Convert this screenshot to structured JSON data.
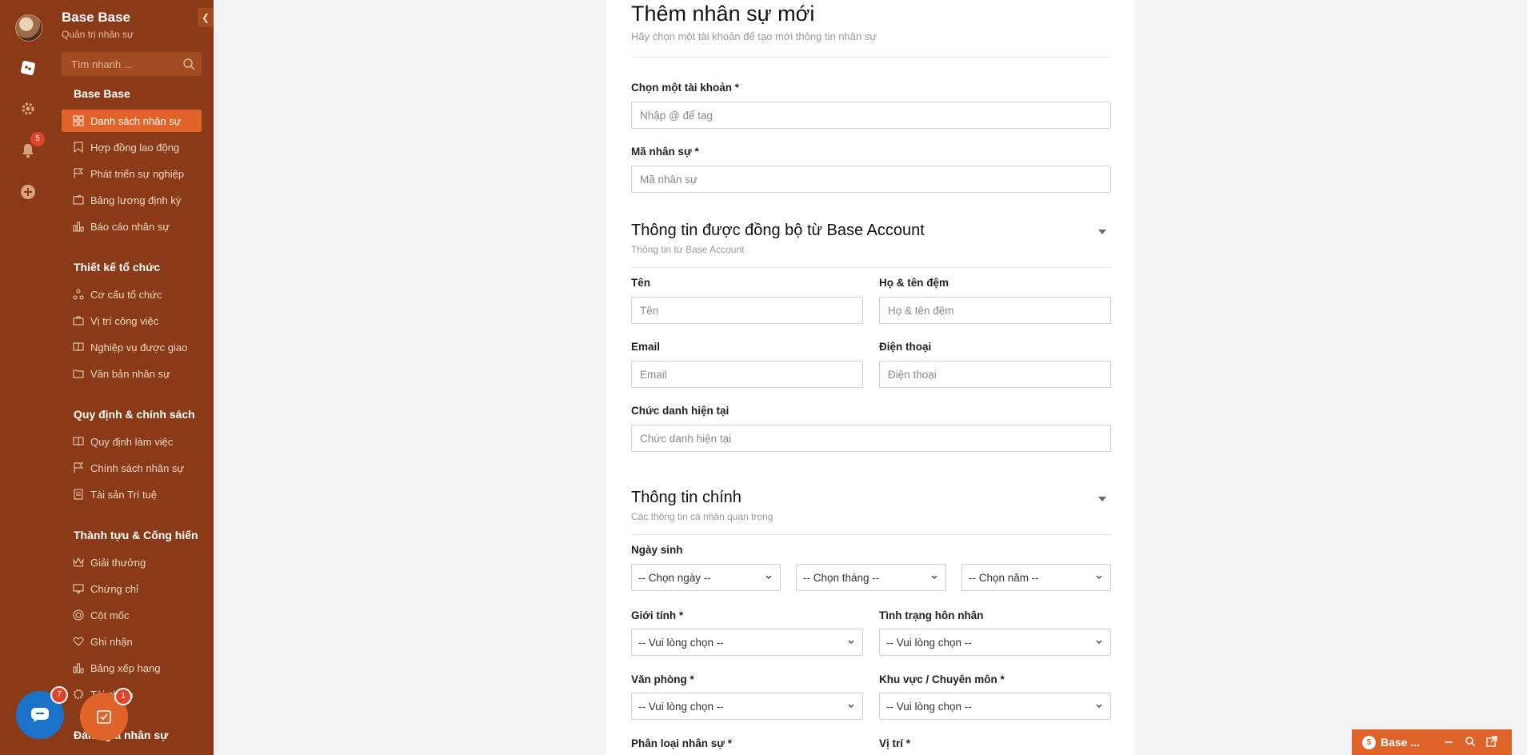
{
  "sidebar": {
    "brand_title": "Base Base",
    "brand_sub": "Quản trị nhân sự",
    "search_placeholder": "Tìm nhanh ...",
    "notification_count": "5",
    "groups": [
      {
        "title": "Base Base",
        "items": [
          {
            "label": "Danh sách nhân sự",
            "icon": "grid-icon",
            "active": true
          },
          {
            "label": "Hợp đồng lao động",
            "icon": "bookmark-icon"
          },
          {
            "label": "Phát triển sự nghiệp",
            "icon": "flag-icon"
          },
          {
            "label": "Bảng lương định kỳ",
            "icon": "wallet-icon"
          },
          {
            "label": "Báo cáo nhân sự",
            "icon": "bar-chart-icon"
          }
        ]
      },
      {
        "title": "Thiết kế tổ chức",
        "items": [
          {
            "label": "Cơ cấu tổ chức",
            "icon": "org-chart-icon"
          },
          {
            "label": "Vị trí công việc",
            "icon": "briefcase-icon"
          },
          {
            "label": "Nghiệp vụ được giao",
            "icon": "book-icon"
          },
          {
            "label": "Văn bản nhân sự",
            "icon": "folder-icon"
          }
        ]
      },
      {
        "title": "Quy định & chính sách",
        "items": [
          {
            "label": "Quy định làm việc",
            "icon": "book-icon"
          },
          {
            "label": "Chính sách nhân sự",
            "icon": "flag-icon"
          },
          {
            "label": "Tài sản Trí tuệ",
            "icon": "document-icon"
          }
        ]
      },
      {
        "title": "Thành tựu & Cống hiến",
        "items": [
          {
            "label": "Giải thưởng",
            "icon": "crown-icon"
          },
          {
            "label": "Chứng chỉ",
            "icon": "certificate-icon"
          },
          {
            "label": "Cột mốc",
            "icon": "target-icon"
          },
          {
            "label": "Ghi nhận",
            "icon": "heart-icon"
          },
          {
            "label": "Bảng xếp hạng",
            "icon": "ranking-icon"
          },
          {
            "label": "Tài chính",
            "icon": "gear-icon"
          }
        ]
      },
      {
        "title": "Đánh giá nhân sự",
        "items": []
      }
    ]
  },
  "form": {
    "title": "Thêm nhân sự mới",
    "subtitle": "Hãy chọn một tài khoản để tạo mới thông tin nhân sự",
    "account_label": "Chọn một tài khoản *",
    "account_placeholder": "Nhập @ để tag",
    "code_label": "Mã nhân sự *",
    "code_placeholder": "Mã nhân sự",
    "sync_section": {
      "title": "Thông tin được đồng bộ từ Base Account",
      "subtitle": "Thông tin từ Base Account",
      "first_name_label": "Tên",
      "first_name_placeholder": "Tên",
      "last_name_label": "Họ & tên đệm",
      "last_name_placeholder": "Họ & tên đệm",
      "email_label": "Email",
      "email_placeholder": "Email",
      "phone_label": "Điện thoại",
      "phone_placeholder": "Điện thoại",
      "title_label": "Chức danh hiện tại",
      "title_placeholder": "Chức danh hiện tại"
    },
    "main_section": {
      "title": "Thông tin chính",
      "subtitle": "Các thông tin cá nhân quan trọng",
      "dob_label": "Ngày sinh",
      "day_select": "-- Chọn ngày --",
      "month_select": "-- Chọn tháng --",
      "year_select": "-- Chọn năm --",
      "gender_label": "Giới tính *",
      "gender_select": "-- Vui lòng chọn --",
      "marital_label": "Tình trạng hôn nhân",
      "marital_select": "-- Vui lòng chọn --",
      "office_label": "Văn phòng *",
      "office_select": "-- Vui lòng chọn --",
      "region_label": "Khu vực / Chuyên môn *",
      "region_select": "-- Vui lòng chọn --",
      "type_label": "Phân loại nhân sự *",
      "position_label": "Vị trí *"
    }
  },
  "floating": {
    "chat_badge": "7",
    "task_badge": "1",
    "mini_count": "5",
    "mini_label": "Base ..."
  },
  "colors": {
    "sidebar": "#8a3a16",
    "accent": "#e0642a"
  }
}
